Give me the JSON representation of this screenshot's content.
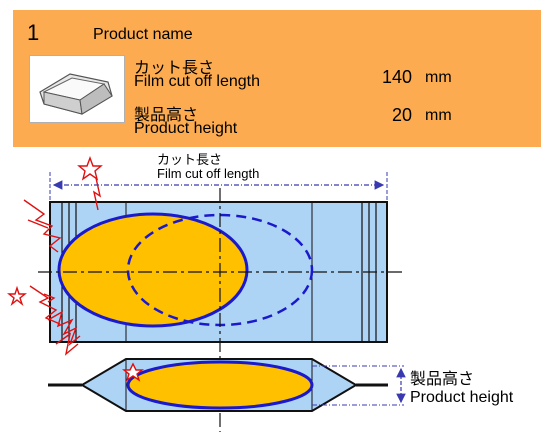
{
  "product": {
    "number": "1",
    "name_label": "Product name"
  },
  "fields": {
    "film_cut_length": {
      "label_ja": "カット長さ",
      "label_en": "Film cut off length",
      "value": "140",
      "unit": "mm"
    },
    "product_height": {
      "label_ja": "製品高さ",
      "label_en": "Product height",
      "value": "20",
      "unit": "mm"
    }
  },
  "diagram": {
    "cut_label_ja": "カット長さ",
    "cut_label_en": "Film cut off length",
    "height_label_ja": "製品高さ",
    "height_label_en": "Product height"
  },
  "colors": {
    "panel_bg": "#fdab50",
    "film_blue": "#aed4f5",
    "product_yellow": "#ffc000",
    "outline_blue": "#1a1acc",
    "dim_blue": "#3a3ab0"
  },
  "icons": {
    "thumbnail": "product-tray-icon",
    "spark": "spark-star-icon"
  }
}
